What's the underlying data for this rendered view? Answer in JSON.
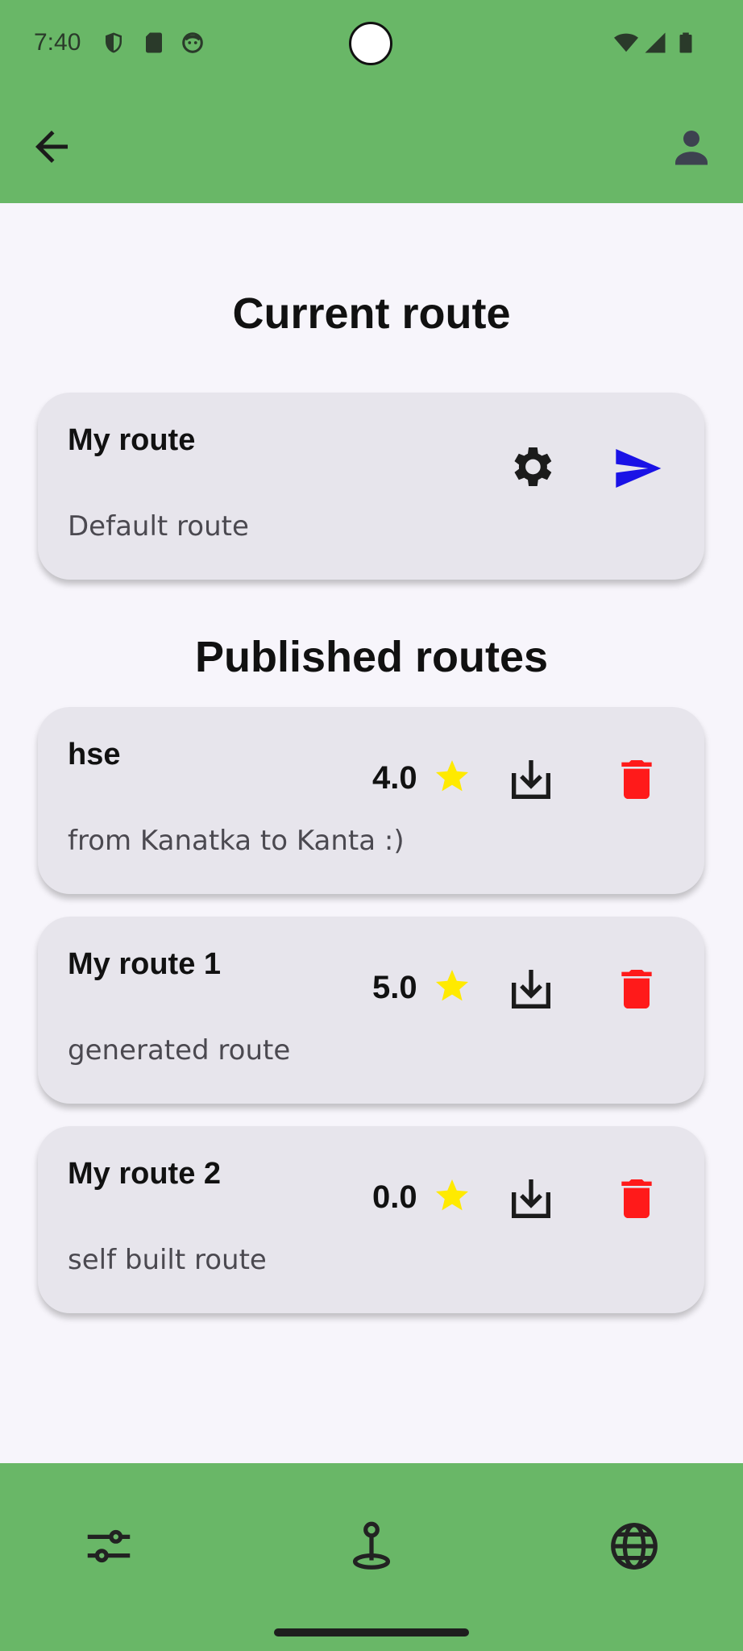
{
  "status_bar": {
    "time": "7:40"
  },
  "colors": {
    "app_bar": "#69b767",
    "card_bg": "#e7e5ec",
    "send": "#1a12e6",
    "delete": "#ff1a1a",
    "star": "#ffea00"
  },
  "current_section": {
    "title": "Current route",
    "route": {
      "name": "My route",
      "description": "Default route",
      "icons": [
        "settings-icon",
        "send-icon"
      ]
    }
  },
  "published_section": {
    "title": "Published routes",
    "routes": [
      {
        "name": "hse",
        "description": "from Kanatka to Kanta :)",
        "rating": "4.0"
      },
      {
        "name": "My route 1",
        "description": "generated route",
        "rating": "5.0"
      },
      {
        "name": "My route 2",
        "description": "self built route",
        "rating": "0.0"
      }
    ]
  },
  "bottom_nav": {
    "items": [
      "filters-icon",
      "route-pin-icon",
      "globe-icon"
    ]
  }
}
